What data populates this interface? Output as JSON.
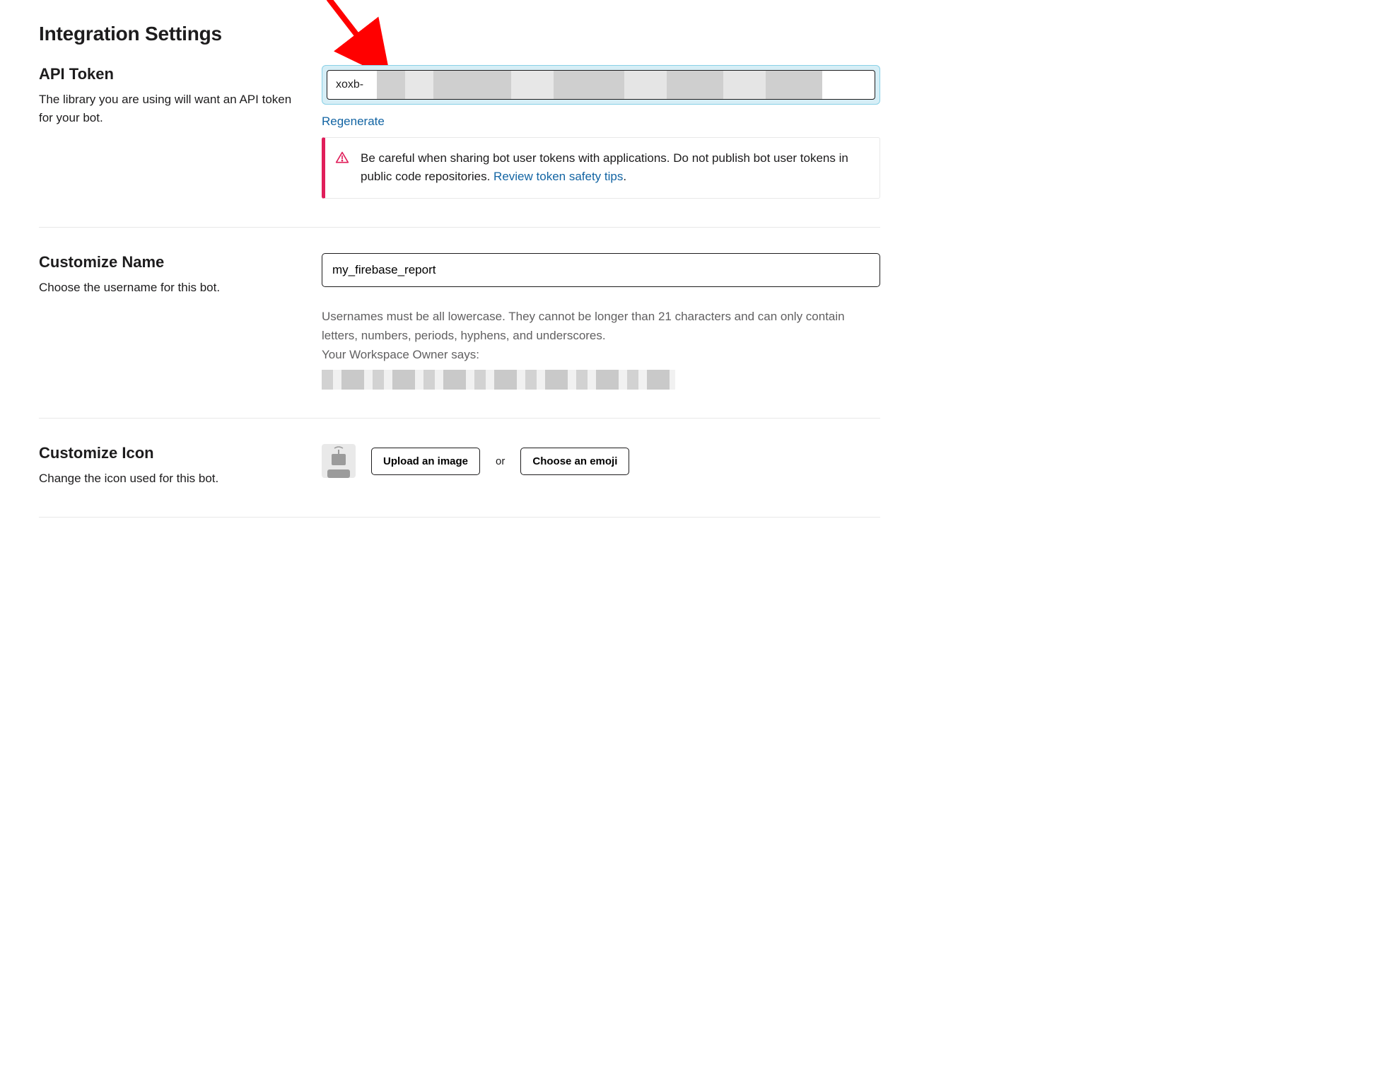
{
  "page_title": "Integration Settings",
  "api_token": {
    "heading": "API Token",
    "description": "The library you are using will want an API token for your bot.",
    "token_prefix": "xoxb-",
    "regenerate_label": "Regenerate",
    "warning_text_1": "Be careful when sharing bot user tokens with applications. Do not publish bot user tokens in public code repositories. ",
    "warning_link_label": "Review token safety tips",
    "warning_text_2": "."
  },
  "customize_name": {
    "heading": "Customize Name",
    "description": "Choose the username for this bot.",
    "value": "my_firebase_report",
    "helper_line1": "Usernames must be all lowercase. They cannot be longer than 21 characters and can only contain letters, numbers, periods, hyphens, and underscores.",
    "helper_line2": "Your Workspace Owner says:"
  },
  "customize_icon": {
    "heading": "Customize Icon",
    "description": "Change the icon used for this bot.",
    "upload_label": "Upload an image",
    "or_label": "or",
    "emoji_label": "Choose an emoji"
  }
}
